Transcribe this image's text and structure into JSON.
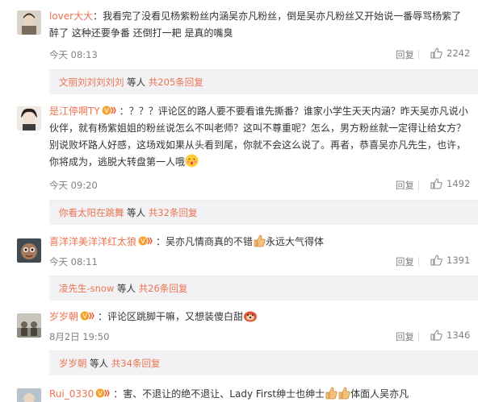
{
  "comments": [
    {
      "username": "lover大大",
      "separator": "：",
      "text_line1": "我看完了没看见杨紫粉丝内涵吴亦凡粉丝，倒是吴亦凡粉丝又开始说一番辱骂杨紫了",
      "text_line2": "醉了 这种还要争番 还倒打一耙 是真的嘴臭",
      "time": "今天 08:13",
      "reply_label": "回复",
      "likes": "2242",
      "sub": {
        "user": "文丽刘刘刘刘刘",
        "etc": " 等人 ",
        "more": "共205条回复"
      }
    },
    {
      "username": "是江停啊TY",
      "separator": "：",
      "text_line1": "？？？评论区的路人要不要看谁先撕番？谁家小学生天天内涵？昨天吴亦凡说小",
      "text_line2": "伙伴，就有杨紫姐姐的粉丝说怎么不叫老师？这叫不尊重呢？怎么，男方粉丝就一定得让给女方？",
      "text_line3": "别说败坏路人好感，这场戏如果从头看到尾，你就不会这么说了。再者，恭喜吴亦凡先生，也许，",
      "text_line4": "你将成为，逃脱大转盘第一人哦",
      "time": "今天 09:20",
      "reply_label": "回复",
      "likes": "1492",
      "sub": {
        "user": "你看太阳在跳舞",
        "etc": " 等人 ",
        "more": "共32条回复"
      }
    },
    {
      "username": "喜洋洋美洋洋红太狼",
      "separator": "：",
      "text_line1a": "吴亦凡情商真的不错",
      "text_line1b": "永远大气得体",
      "time": "今天 08:11",
      "reply_label": "回复",
      "likes": "1391",
      "sub": {
        "user": "凌先生-snow",
        "etc": " 等人 ",
        "more": "共26条回复"
      }
    },
    {
      "username": "岁岁朝",
      "separator": "：",
      "text_line1": "评论区跳脚干嘛，又想装傻白甜",
      "time": "8月2日 19:50",
      "reply_label": "回复",
      "likes": "1346",
      "sub": {
        "user": "岁岁朝",
        "etc": " 等人 ",
        "more": "共34条回复"
      }
    },
    {
      "username": "Rui_0330",
      "separator": "：",
      "text_line1a": "害、不退让的绝不退让、Lady First绅士也绅士",
      "text_line1b": "体面人吴亦凡"
    }
  ],
  "colors": {
    "link": "#eb7350",
    "meta": "#808080",
    "sub_bg": "#f2f2f5"
  },
  "icons": {
    "like": "thumbs-up-icon",
    "vip": "vip-badge-icon"
  }
}
